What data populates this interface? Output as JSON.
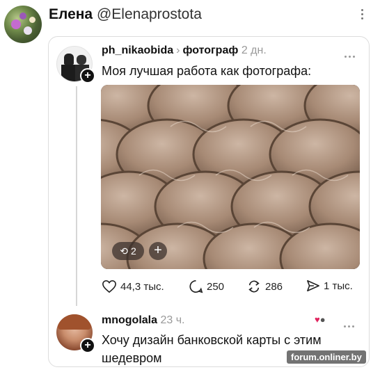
{
  "outer_post": {
    "author_name": "Елена",
    "author_handle": "@Elenaprostota"
  },
  "quoted_post": {
    "username": "ph_nikaobida",
    "chevron": "›",
    "topic": "фотограф",
    "time": "2 дн.",
    "caption": "Моя лучшая работа как фотографа:",
    "photo_badges": {
      "repost_count": "2",
      "plus": "+"
    },
    "actions": {
      "likes": "44,3 тыс.",
      "comments": "250",
      "reposts": "286",
      "shares": "1 тыс."
    },
    "icons": [
      "heart-icon",
      "comment-icon",
      "repost-icon",
      "send-icon",
      "more-horizontal-icon"
    ]
  },
  "reply": {
    "username": "mnogolala",
    "time": "23 ч.",
    "text": "Хочу дизайн банковской карты с этим шедевром"
  },
  "watermark": "forum.onliner.by",
  "colors": {
    "border": "#dcdcdc",
    "muted_text": "#999999",
    "coin_dark": "#5e4a3a",
    "coin_light": "#b59a86"
  }
}
